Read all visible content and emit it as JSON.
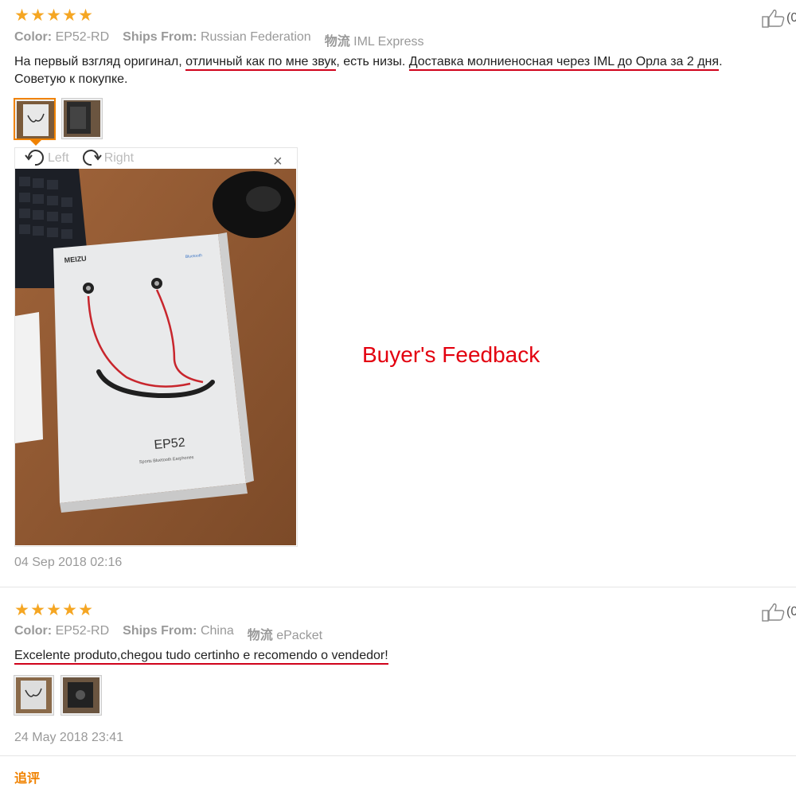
{
  "reviews": [
    {
      "rating": 5,
      "like_count": "(0",
      "color_label": "Color:",
      "color_value": "EP52-RD",
      "ships_label": "Ships From:",
      "ships_value": "Russian Federation",
      "logistics_label": "物流",
      "logistics_value": "IML Express",
      "text": {
        "p1": "На первый взгляд оригинал, ",
        "u1": "отличный как по мне звук",
        "p2": ", есть низы. ",
        "u2": "Доставка молниеносная через IML до Орла за 2 дня",
        "p3": ".",
        "line2": "Советую к покупке."
      },
      "viewer": {
        "rotate_left_label": "Left",
        "rotate_right_label": "Right",
        "close_label": "×",
        "image_brand": "MEIZU",
        "image_model": "EP52",
        "image_caption": "Sports Bluetooth Earphones",
        "image_badge": "Bluetooth"
      },
      "date": "04 Sep 2018 02:16"
    },
    {
      "rating": 5,
      "like_count": "(0",
      "color_label": "Color:",
      "color_value": "EP52-RD",
      "ships_label": "Ships From:",
      "ships_value": "China",
      "logistics_label": "物流",
      "logistics_value": "ePacket",
      "text": {
        "u1": "Excelente produto,chegou tudo certinho e recomendo o vendedor!"
      },
      "date": "24 May 2018 23:41"
    }
  ],
  "annotation": "Buyer's Feedback",
  "followup_label": "追评",
  "icons": {
    "star": "★",
    "like": "thumbs-up-icon",
    "rotate_left": "rotate-left-icon",
    "rotate_right": "rotate-right-icon",
    "close": "close-icon"
  },
  "colors": {
    "star": "#f5a623",
    "underline": "#d0021b",
    "annotation": "#e3000f",
    "active_thumb": "#f08200"
  }
}
